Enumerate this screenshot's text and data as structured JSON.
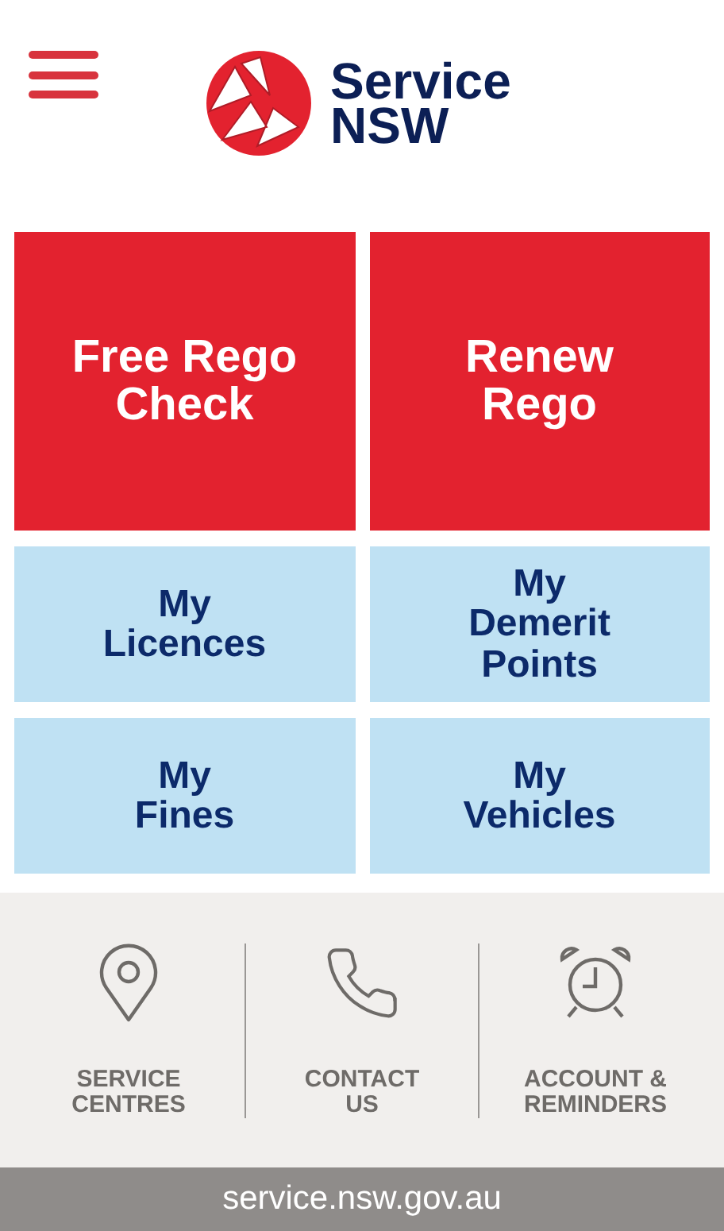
{
  "header": {
    "logo_lines": [
      "Service",
      "NSW"
    ]
  },
  "tiles": [
    {
      "kind": "primary",
      "lines": [
        "Free Rego",
        "Check"
      ]
    },
    {
      "kind": "primary",
      "lines": [
        "Renew",
        "Rego"
      ]
    },
    {
      "kind": "secondary",
      "lines": [
        "My",
        "Licences"
      ]
    },
    {
      "kind": "secondary",
      "lines": [
        "My",
        "Demerit",
        "Points"
      ]
    },
    {
      "kind": "secondary",
      "lines": [
        "My",
        "Fines"
      ]
    },
    {
      "kind": "secondary",
      "lines": [
        "My",
        "Vehicles"
      ]
    }
  ],
  "shortcuts": [
    {
      "kind": "location",
      "lines": [
        "SERVICE",
        "CENTRES"
      ]
    },
    {
      "kind": "phone",
      "lines": [
        "CONTACT",
        "US"
      ]
    },
    {
      "kind": "alarm",
      "lines": [
        "ACCOUNT &",
        "REMINDERS"
      ]
    }
  ],
  "footer": {
    "url": "service.nsw.gov.au"
  }
}
